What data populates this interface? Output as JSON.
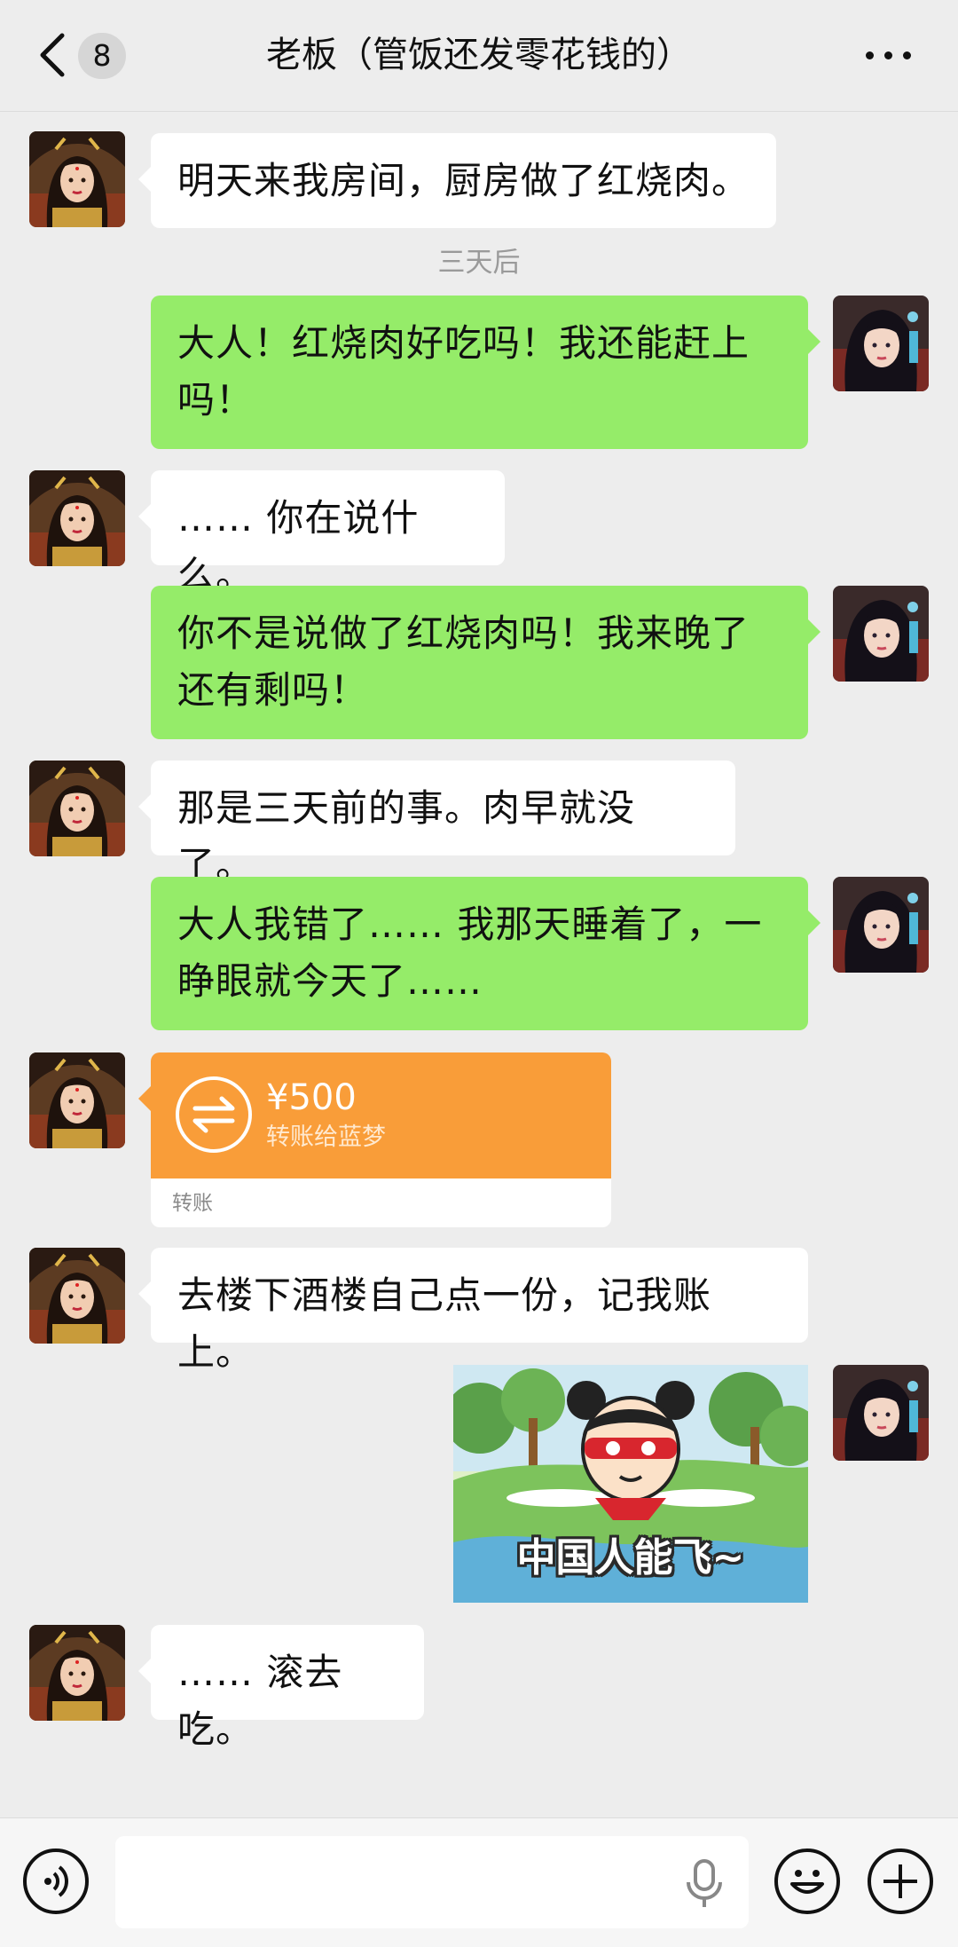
{
  "header": {
    "unread_count": "8",
    "title": "老板（管饭还发零花钱的）"
  },
  "messages": {
    "m1": "明天来我房间，厨房做了红烧肉。",
    "time1": "三天后",
    "m2_line1": "大人！红烧肉好吃吗！我还能赶上",
    "m2_line2": "吗！",
    "m3": "…… 你在说什么。",
    "m4_line1": "你不是说做了红烧肉吗！我来晚了",
    "m4_line2": "还有剩吗！",
    "m5": "那是三天前的事。肉早就没了。",
    "m6_line1": "大人我错了…… 我那天睡着了，一",
    "m6_line2": "睁眼就今天了……",
    "transfer": {
      "amount": "¥500",
      "recipient": "转账给蓝梦",
      "type_label": "转账"
    },
    "m8": "去楼下酒楼自己点一份，记我账上。",
    "sticker_caption": "中国人能飞~",
    "m10": "…… 滚去吃。"
  },
  "input": {
    "placeholder": ""
  },
  "colors": {
    "background": "#ededed",
    "outgoing_bubble": "#95ec69",
    "incoming_bubble": "#ffffff",
    "transfer": "#f99d39"
  },
  "icons": [
    "back-icon",
    "more-icon",
    "transfer-icon",
    "microphone-icon",
    "voice-icon",
    "emoji-icon",
    "plus-icon"
  ]
}
